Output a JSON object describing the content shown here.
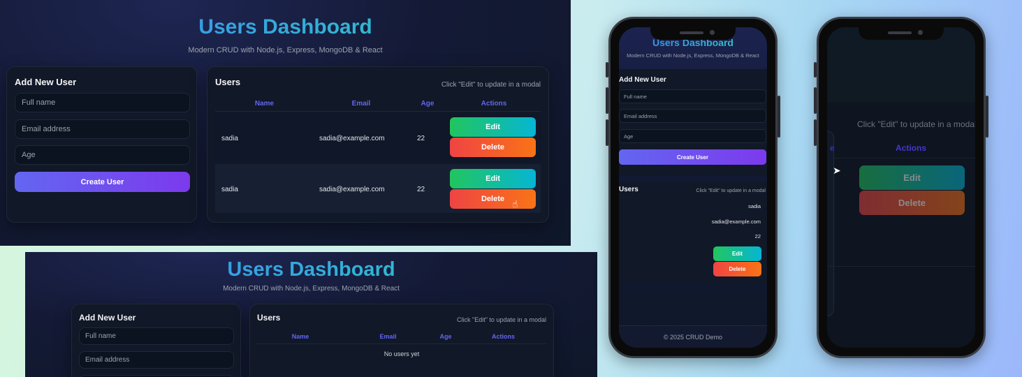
{
  "app": {
    "title": "Users Dashboard",
    "subtitle": "Modern CRUD with Node.js, Express, MongoDB & React"
  },
  "form": {
    "heading": "Add New User",
    "name_placeholder": "Full name",
    "email_placeholder": "Email address",
    "age_placeholder": "Age",
    "create_label": "Create User"
  },
  "users_card": {
    "heading": "Users",
    "hint": "Click \"Edit\" to update in a modal",
    "columns": [
      "Name",
      "Email",
      "Age",
      "Actions"
    ],
    "edit_label": "Edit",
    "delete_label": "Delete",
    "empty_text": "No users yet"
  },
  "rows": [
    {
      "name": "sadia",
      "email": "sadia@example.com",
      "age": "22"
    },
    {
      "name": "sadia",
      "email": "sadia@example.com",
      "age": "22"
    }
  ],
  "footer": "© 2025 CRUD Demo",
  "colors": {
    "accent_header": "#6366f1",
    "create_gradient": [
      "#6366f1",
      "#7c3aed"
    ],
    "edit_gradient": [
      "#22c55e",
      "#06b6d4"
    ],
    "delete_gradient": [
      "#ef4444",
      "#f97316"
    ]
  },
  "icons": [
    "pointer-hand-icon",
    "arrow-cursor-icon"
  ]
}
